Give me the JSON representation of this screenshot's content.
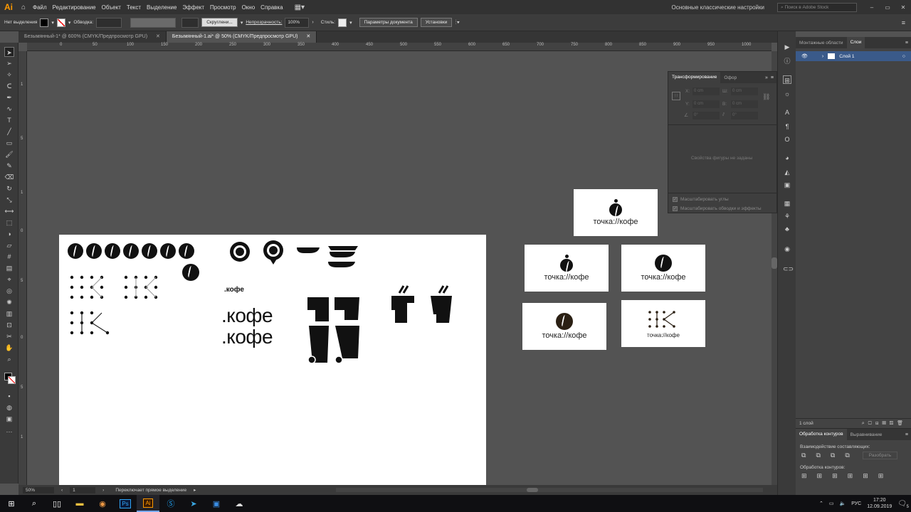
{
  "app": {
    "logo": "Ai",
    "workspace": "Основные классические настройки",
    "stock_placeholder": "Поиск в Adobe Stock"
  },
  "menu": [
    "Файл",
    "Редактирование",
    "Объект",
    "Текст",
    "Выделение",
    "Эффект",
    "Просмотр",
    "Окно",
    "Справка"
  ],
  "control": {
    "selection": "Нет выделения",
    "stroke_label": "Обводка:",
    "rounded": "Скруглени...",
    "opacity_label": "Непрозрачность:",
    "opacity_value": "100%",
    "styles_label": "Стиль:",
    "doc_params": "Параметры документа",
    "install": "Установки"
  },
  "tabs": [
    {
      "label": "Безымянный-1* @ 600% (CMYK/Предпросмотр GPU)"
    },
    {
      "label": "Безымянный-1.ai* @ 50% (CMYK/Предпросмотр GPU)"
    }
  ],
  "ruler_h": [
    "0",
    "50",
    "100",
    "150",
    "200",
    "250",
    "300",
    "350",
    "400",
    "450",
    "500",
    "550",
    "600",
    "650",
    "700",
    "750",
    "800",
    "850",
    "900",
    "950",
    "1000",
    "1050"
  ],
  "ruler_v": [
    "1",
    "5",
    "1",
    "0",
    "5",
    "0",
    "5",
    "1",
    "0",
    "1",
    "5",
    "2",
    "0",
    "2",
    "5"
  ],
  "artwork": {
    "kofe_small": ".кофе",
    "kofe_large_1": ".кофе",
    "kofe_large_2": ".кофе"
  },
  "cards": {
    "brand": "точка://кофе"
  },
  "transform_panel": {
    "tab1": "Трансформирование",
    "tab2": "Офор",
    "fields": [
      "X:",
      "Y:",
      "Ш:",
      "В:"
    ],
    "field_value": "0 cm",
    "angle_value": "0°",
    "empty_note": "Свойства фигуры не заданы",
    "check1": "Масштабировать углы",
    "check2": "Масштабировать обводки и эффекты"
  },
  "layers_panel": {
    "tab1": "Монтажные области",
    "tab2": "Слои",
    "layer_name": "Слой 1",
    "count": "1 слой"
  },
  "pathfinder": {
    "tab1": "Обработка контуров",
    "tab2": "Выравнивание",
    "shape_modes": "Взаимодействие составляющих:",
    "pathfinders": "Обработка контуров:",
    "expand": "Разобрать"
  },
  "status": {
    "zoom": "50%",
    "artboard": "1",
    "tool_hint": "Переключает прямое выделение"
  },
  "taskbar": {
    "lang": "РУС",
    "time": "17:20",
    "date": "12.09.2019",
    "notifications": "5"
  },
  "colors": {
    "ui_dark": "#323232",
    "canvas": "#535353",
    "accent_ai": "#ff9a00",
    "layer_select": "#3a5a8a"
  }
}
